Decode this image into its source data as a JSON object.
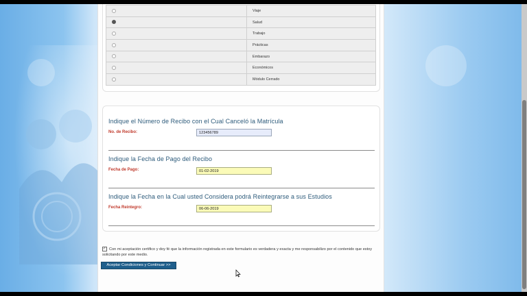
{
  "options": [
    {
      "label": "Viaje",
      "selected": false
    },
    {
      "label": "Salud",
      "selected": true
    },
    {
      "label": "Trabajo",
      "selected": false
    },
    {
      "label": "Prácticas",
      "selected": false
    },
    {
      "label": "Embarazo",
      "selected": false
    },
    {
      "label": "Económicos",
      "selected": false
    },
    {
      "label": "Módulo Cerrado",
      "selected": false
    }
  ],
  "receipt": {
    "title": "Indique el Número de Recibo con el Cual Canceló la Matrícula",
    "label": "No. de Recibo:",
    "value": "123456789"
  },
  "payment_date": {
    "title": "Indique la Fecha de Pago del Recibo",
    "label": "Fecha de Pago:",
    "value": "01-02-2019"
  },
  "reentry_date": {
    "title": "Indique la Fecha en la Cual usted Considera podrá Reintegrarse a sus Estudios",
    "label": "Fecha Reintegro:",
    "value": "06-06-2019"
  },
  "consent": {
    "text": "Con mi aceptación certifico y doy fé que la información registrada en este formulario es verdadera y exacta y me responsabilizo por el contenido que estoy solicitando por este medio.",
    "checked": true
  },
  "submit_label": "Aceptar Condiciones y Continuar >>",
  "colors": {
    "title": "#2c5a7a",
    "label": "#c0392b",
    "button": "#1f5f8c",
    "input_blue": "#e7ecfb",
    "input_yellow": "#fbfbb8"
  }
}
